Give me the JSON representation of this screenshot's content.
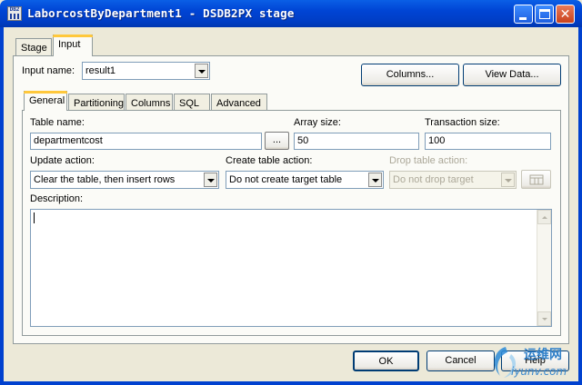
{
  "window": {
    "title": "LaborcostByDepartment1 - DSDB2PX stage",
    "app_icon_label": "DB2"
  },
  "outer_tabs": [
    {
      "label": "Stage"
    },
    {
      "label": "Input"
    }
  ],
  "input_name": {
    "label": "Input name:",
    "value": "result1"
  },
  "top_buttons": {
    "columns": "Columns...",
    "view_data": "View Data..."
  },
  "inner_tabs": [
    {
      "label": "General"
    },
    {
      "label": "Partitioning"
    },
    {
      "label": "Columns"
    },
    {
      "label": "SQL"
    },
    {
      "label": "Advanced"
    }
  ],
  "general": {
    "table_name": {
      "label": "Table name:",
      "value": "departmentcost",
      "browse": "..."
    },
    "array_size": {
      "label": "Array size:",
      "value": "50"
    },
    "transaction_size": {
      "label": "Transaction size:",
      "value": "100"
    },
    "update_action": {
      "label": "Update action:",
      "value": "Clear the table, then insert rows"
    },
    "create_table_action": {
      "label": "Create table action:",
      "value": "Do not create target table"
    },
    "drop_table_action": {
      "label": "Drop table action:",
      "value": "Do not drop target"
    },
    "description": {
      "label": "Description:",
      "value": ""
    }
  },
  "bottom_buttons": {
    "ok": "OK",
    "cancel": "Cancel",
    "help": "Help"
  },
  "watermark": {
    "text": "运维网",
    "url": "iyunv.com"
  },
  "colors": {
    "titlebar": "#0a5fe6",
    "tab_accent": "#ffc83c",
    "face": "#ece9d8",
    "close": "#c9421c"
  }
}
